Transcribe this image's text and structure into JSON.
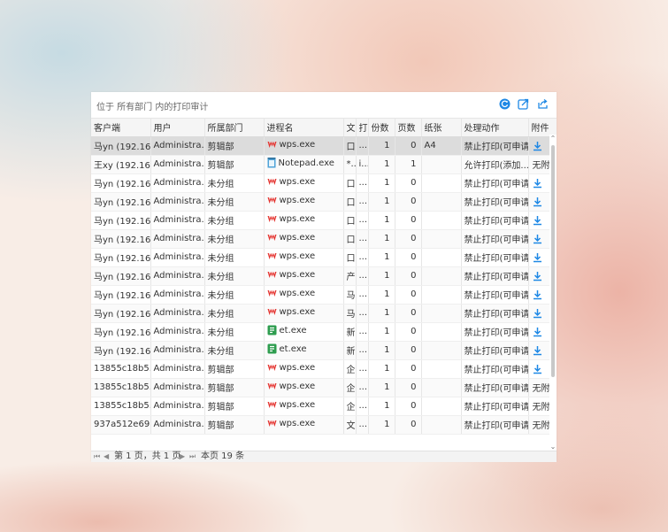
{
  "panel": {
    "title": "位于 所有部门 内的打印审计",
    "toolbar": [
      "refresh-icon",
      "export-icon",
      "share-icon"
    ]
  },
  "columns": [
    "客户端",
    "用户",
    "所属部门",
    "进程名",
    "文",
    "打",
    "份数",
    "页数",
    "纸张",
    "处理动作",
    "附件"
  ],
  "rows": [
    {
      "client": "马yn (192.16...",
      "user": "Administra...",
      "dept": "剪辑部",
      "proc": "wps.exe",
      "icon": "wps",
      "doc": "口",
      "prn": "...",
      "copies": "1",
      "pages": "0",
      "paper": "A4",
      "action": "禁止打印(可申请)",
      "attach": "download",
      "selected": true
    },
    {
      "client": "王xy (192.16...",
      "user": "Administra...",
      "dept": "剪辑部",
      "proc": "Notepad.exe",
      "icon": "notepad",
      "doc": "*...",
      "prn": "i...",
      "copies": "1",
      "pages": "1",
      "paper": "",
      "action": "允许打印(添加...",
      "attach": "无附",
      "selected": false
    },
    {
      "client": "马yn (192.16...",
      "user": "Administra...",
      "dept": "未分组",
      "proc": "wps.exe",
      "icon": "wps",
      "doc": "口",
      "prn": "...",
      "copies": "1",
      "pages": "0",
      "paper": "",
      "action": "禁止打印(可申请)",
      "attach": "download",
      "selected": false
    },
    {
      "client": "马yn (192.16...",
      "user": "Administra...",
      "dept": "未分组",
      "proc": "wps.exe",
      "icon": "wps",
      "doc": "口",
      "prn": "...",
      "copies": "1",
      "pages": "0",
      "paper": "",
      "action": "禁止打印(可申请)",
      "attach": "download",
      "selected": false
    },
    {
      "client": "马yn (192.16...",
      "user": "Administra...",
      "dept": "未分组",
      "proc": "wps.exe",
      "icon": "wps",
      "doc": "口",
      "prn": "...",
      "copies": "1",
      "pages": "0",
      "paper": "",
      "action": "禁止打印(可申请)",
      "attach": "download",
      "selected": false
    },
    {
      "client": "马yn (192.16...",
      "user": "Administra...",
      "dept": "未分组",
      "proc": "wps.exe",
      "icon": "wps",
      "doc": "口",
      "prn": "...",
      "copies": "1",
      "pages": "0",
      "paper": "",
      "action": "禁止打印(可申请)",
      "attach": "download",
      "selected": false
    },
    {
      "client": "马yn (192.16...",
      "user": "Administra...",
      "dept": "未分组",
      "proc": "wps.exe",
      "icon": "wps",
      "doc": "口",
      "prn": "...",
      "copies": "1",
      "pages": "0",
      "paper": "",
      "action": "禁止打印(可申请)",
      "attach": "download",
      "selected": false
    },
    {
      "client": "马yn (192.16...",
      "user": "Administra...",
      "dept": "未分组",
      "proc": "wps.exe",
      "icon": "wps",
      "doc": "产",
      "prn": "...",
      "copies": "1",
      "pages": "0",
      "paper": "",
      "action": "禁止打印(可申请)",
      "attach": "download",
      "selected": false
    },
    {
      "client": "马yn (192.16...",
      "user": "Administra...",
      "dept": "未分组",
      "proc": "wps.exe",
      "icon": "wps",
      "doc": "马",
      "prn": "...",
      "copies": "1",
      "pages": "0",
      "paper": "",
      "action": "禁止打印(可申请)",
      "attach": "download",
      "selected": false
    },
    {
      "client": "马yn (192.16...",
      "user": "Administra...",
      "dept": "未分组",
      "proc": "wps.exe",
      "icon": "wps",
      "doc": "马",
      "prn": "...",
      "copies": "1",
      "pages": "0",
      "paper": "",
      "action": "禁止打印(可申请)",
      "attach": "download",
      "selected": false
    },
    {
      "client": "马yn (192.16...",
      "user": "Administra...",
      "dept": "未分组",
      "proc": "et.exe",
      "icon": "et",
      "doc": "新",
      "prn": "...",
      "copies": "1",
      "pages": "0",
      "paper": "",
      "action": "禁止打印(可申请)",
      "attach": "download",
      "selected": false
    },
    {
      "client": "马yn (192.16...",
      "user": "Administra...",
      "dept": "未分组",
      "proc": "et.exe",
      "icon": "et",
      "doc": "新",
      "prn": "...",
      "copies": "1",
      "pages": "0",
      "paper": "",
      "action": "禁止打印(可申请)",
      "attach": "download",
      "selected": false
    },
    {
      "client": "13855c18b5...",
      "user": "Administra...",
      "dept": "剪辑部",
      "proc": "wps.exe",
      "icon": "wps",
      "doc": "企",
      "prn": "...",
      "copies": "1",
      "pages": "0",
      "paper": "",
      "action": "禁止打印(可申请)",
      "attach": "download",
      "selected": false
    },
    {
      "client": "13855c18b5...",
      "user": "Administra...",
      "dept": "剪辑部",
      "proc": "wps.exe",
      "icon": "wps",
      "doc": "企",
      "prn": "...",
      "copies": "1",
      "pages": "0",
      "paper": "",
      "action": "禁止打印(可申请)",
      "attach": "无附",
      "selected": false
    },
    {
      "client": "13855c18b5...",
      "user": "Administra...",
      "dept": "剪辑部",
      "proc": "wps.exe",
      "icon": "wps",
      "doc": "企",
      "prn": "...",
      "copies": "1",
      "pages": "0",
      "paper": "",
      "action": "禁止打印(可申请)",
      "attach": "无附",
      "selected": false
    },
    {
      "client": "937a512e69...",
      "user": "Administra...",
      "dept": "剪辑部",
      "proc": "wps.exe",
      "icon": "wps",
      "doc": "文",
      "prn": "...",
      "copies": "1",
      "pages": "0",
      "paper": "",
      "action": "禁止打印(可申请)",
      "attach": "无附",
      "selected": false
    }
  ],
  "pager": {
    "first": "first-page-icon",
    "prev": "prev-page-icon",
    "page_info": "第 1 页，共 1 页",
    "next": "next-page-icon",
    "last": "last-page-icon",
    "count_info": "本页 19 条"
  },
  "colors": {
    "accent": "#1e88e5",
    "wps_red": "#e53935",
    "et_green": "#2e9d4f"
  }
}
